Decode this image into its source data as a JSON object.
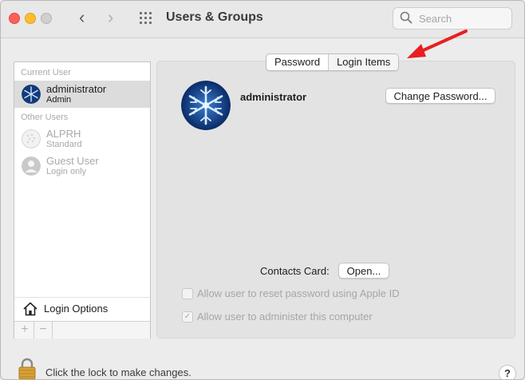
{
  "window": {
    "title": "Users & Groups",
    "nav_back": "‹",
    "nav_forward": "›"
  },
  "search": {
    "placeholder": "Search",
    "value": ""
  },
  "sidebar": {
    "current_user_header": "Current User",
    "other_users_header": "Other Users",
    "users": [
      {
        "name": "administrator",
        "role": "Admin"
      },
      {
        "name": "ALPRH",
        "role": "Standard"
      },
      {
        "name": "Guest User",
        "role": "Login only"
      }
    ],
    "login_options": "Login Options",
    "add_label": "+",
    "remove_label": "−"
  },
  "tabs": [
    {
      "label": "Password",
      "selected": true
    },
    {
      "label": "Login Items",
      "selected": false
    }
  ],
  "main": {
    "user_name": "administrator",
    "change_password": "Change Password...",
    "contacts_card_label": "Contacts Card:",
    "open_button": "Open...",
    "checkboxes": [
      {
        "label": "Allow user to reset password using Apple ID",
        "checked": false,
        "enabled": false
      },
      {
        "label": "Allow user to administer this computer",
        "checked": true,
        "enabled": false
      }
    ]
  },
  "footer": {
    "lock_text": "Click the lock to make changes.",
    "help": "?"
  },
  "colors": {
    "annotation_arrow": "#e82020",
    "selection": "#dcdcdc"
  }
}
